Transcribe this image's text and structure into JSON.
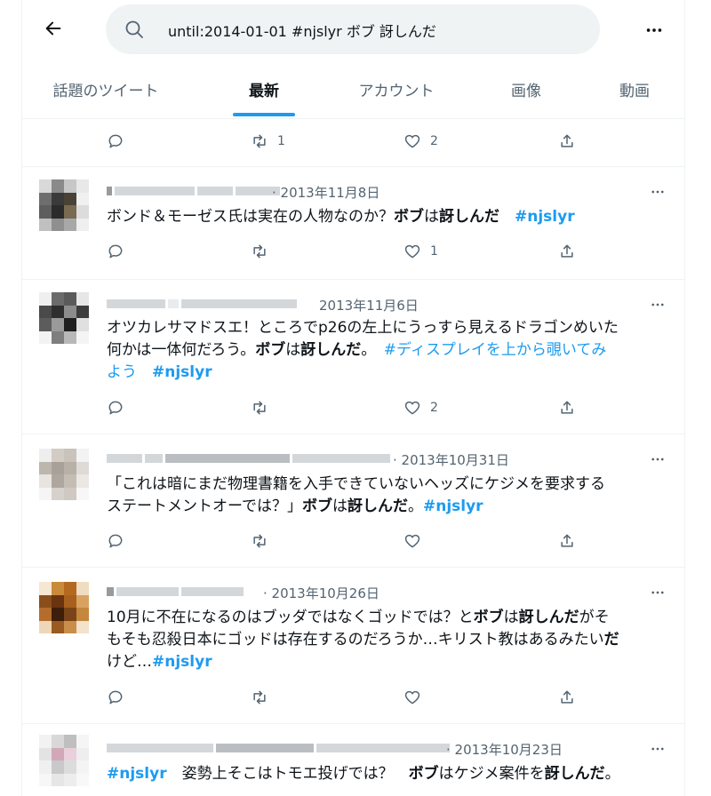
{
  "search": {
    "query": "until:2014-01-01 #njslyr ボブ 訝しんだ"
  },
  "tabs": [
    {
      "label": "話題のツイート"
    },
    {
      "label": "最新"
    },
    {
      "label": "アカウント"
    },
    {
      "label": "画像"
    },
    {
      "label": "動画"
    }
  ],
  "active_tab": "最新",
  "colors": {
    "accent": "#1d9bf0",
    "text": "#0f1419",
    "muted": "#536471",
    "divider": "#eff3f4"
  },
  "top_action_bar": {
    "retweets": "1",
    "likes": "2"
  },
  "tweets": [
    {
      "date": "· 2013年11月8日",
      "lines": [
        [
          {
            "t": "ボンド＆モーゼス氏は実在の人物なのか？",
            "s": ""
          },
          {
            "t": "ボブ",
            "s": "b"
          },
          {
            "t": "は",
            "s": ""
          },
          {
            "t": "訝しんだ",
            "s": "b"
          },
          {
            "t": "　",
            "s": ""
          },
          {
            "t": "#njslyr",
            "s": "tagb"
          }
        ]
      ],
      "retweets": "",
      "likes": "1"
    },
    {
      "date": "2013年11月6日",
      "lines": [
        [
          {
            "t": "オツカレサマドスエ！ところでp26の左上にうっすら見えるドラゴンめいた",
            "s": ""
          }
        ],
        [
          {
            "t": "何かは一体何だろう。",
            "s": ""
          },
          {
            "t": "ボブ",
            "s": "b"
          },
          {
            "t": "は",
            "s": ""
          },
          {
            "t": "訝しんだ",
            "s": "b"
          },
          {
            "t": "。　",
            "s": ""
          },
          {
            "t": "#ディスプレイを上から覗いてみ",
            "s": "tag"
          }
        ],
        [
          {
            "t": "よう　",
            "s": "tag"
          },
          {
            "t": "#njslyr",
            "s": "tagb"
          }
        ]
      ],
      "retweets": "",
      "likes": "2"
    },
    {
      "date": "· 2013年10月31日",
      "lines": [
        [
          {
            "t": "「これは暗にまだ物理書籍を入手できていないヘッズにケジメを要求する",
            "s": ""
          }
        ],
        [
          {
            "t": "ステートメントオーでは？」",
            "s": ""
          },
          {
            "t": "ボブ",
            "s": "b"
          },
          {
            "t": "は",
            "s": ""
          },
          {
            "t": "訝しんだ",
            "s": "b"
          },
          {
            "t": "。",
            "s": ""
          },
          {
            "t": "#njslyr",
            "s": "tagb"
          }
        ]
      ],
      "retweets": "",
      "likes": ""
    },
    {
      "date": "· 2013年10月26日",
      "lines": [
        [
          {
            "t": "10月に不在になるのはブッダではなくゴッドでは？と",
            "s": ""
          },
          {
            "t": "ボブ",
            "s": "b"
          },
          {
            "t": "は",
            "s": ""
          },
          {
            "t": "訝しんだ",
            "s": "b"
          },
          {
            "t": "がそ",
            "s": ""
          }
        ],
        [
          {
            "t": "もそも忍殺日本にゴッドは存在するのだろうか…キリスト教はあるみたい",
            "s": ""
          },
          {
            "t": "だ",
            "s": "b"
          }
        ],
        [
          {
            "t": "けど…",
            "s": ""
          },
          {
            "t": "#njslyr",
            "s": "tagb"
          }
        ]
      ],
      "retweets": "",
      "likes": ""
    },
    {
      "date": "· 2013年10月23日",
      "lines": [
        [
          {
            "t": "#njslyr",
            "s": "tagb"
          },
          {
            "t": "　姿勢上そこはトモエ投げでは？　",
            "s": ""
          },
          {
            "t": "ボブ",
            "s": "b"
          },
          {
            "t": "はケジメ案件を",
            "s": ""
          },
          {
            "t": "訝しんだ",
            "s": "b"
          },
          {
            "t": "。",
            "s": ""
          }
        ]
      ],
      "retweets": "",
      "likes": ""
    }
  ],
  "icons": [
    "back-arrow-icon",
    "search-icon",
    "more-icon",
    "reply-icon",
    "retweet-icon",
    "like-icon",
    "share-icon"
  ]
}
